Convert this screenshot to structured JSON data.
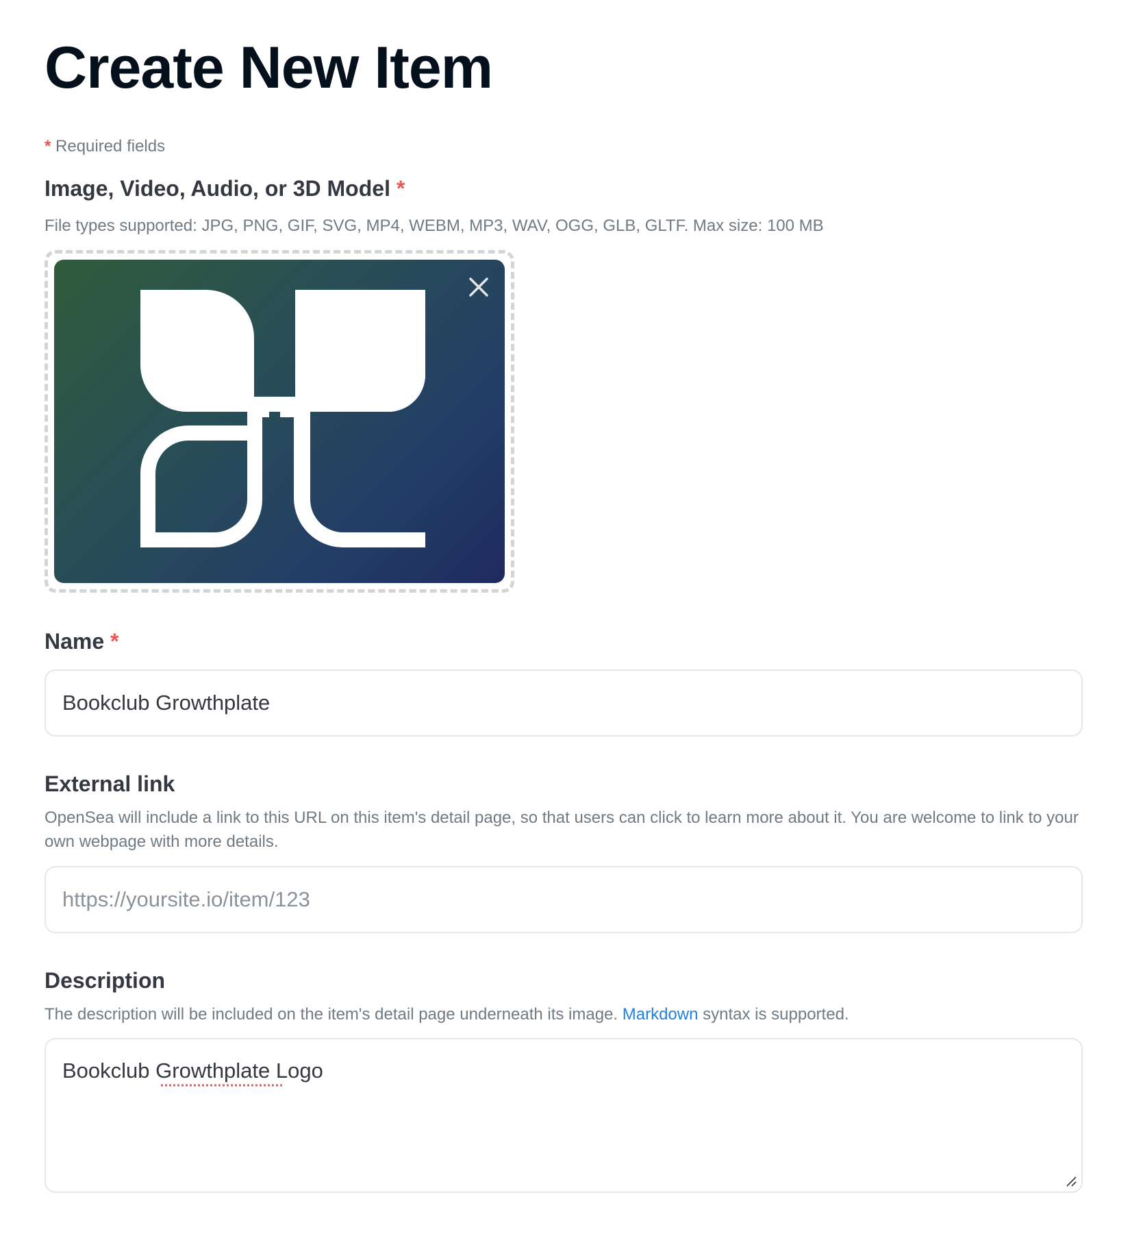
{
  "page": {
    "title": "Create New Item",
    "required_note": {
      "asterisk": "*",
      "text": " Required fields"
    }
  },
  "media": {
    "label": "Image, Video, Audio, or 3D Model",
    "asterisk": "*",
    "help": "File types supported: JPG, PNG, GIF, SVG, MP4, WEBM, MP3, WAV, OGG, GLB, GLTF. Max size: 100 MB",
    "remove_icon": "close-icon",
    "preview_icon": "leaf-logo"
  },
  "name_field": {
    "label": "Name",
    "asterisk": "*",
    "value": "Bookclub Growthplate"
  },
  "external_link": {
    "label": "External link",
    "help": "OpenSea will include a link to this URL on this item's detail page, so that users can click to learn more about it. You are welcome to link to your own webpage with more details.",
    "placeholder": "https://yoursite.io/item/123",
    "value": ""
  },
  "description": {
    "label": "Description",
    "help_before": "The description will be included on the item's detail page underneath its image. ",
    "help_link": "Markdown",
    "help_after": " syntax is supported.",
    "value": "Bookclub Growthplate Logo"
  },
  "colors": {
    "accent_link": "#2081e2",
    "required": "#eb5757",
    "text_primary": "#04111d",
    "text_secondary": "#707a83",
    "border": "#e5e8eb"
  }
}
